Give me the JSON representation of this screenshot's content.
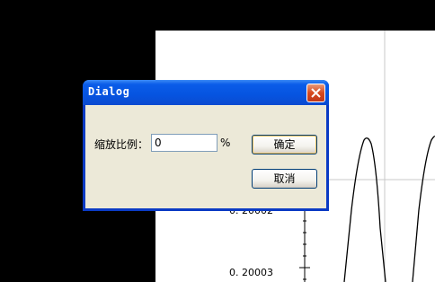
{
  "background": {
    "y_tick_labels": [
      "0. 20002",
      "0. 20003"
    ]
  },
  "dialog": {
    "title": "Dialog",
    "scale_label": "缩放比例：",
    "scale_value": "0",
    "unit": "%",
    "ok_label": "确定",
    "cancel_label": "取消"
  },
  "colors": {
    "titlebar": "#0a5ce8",
    "close_button": "#d6491e",
    "dialog_face": "#ece9d8",
    "plot_background": "#ffffff"
  }
}
